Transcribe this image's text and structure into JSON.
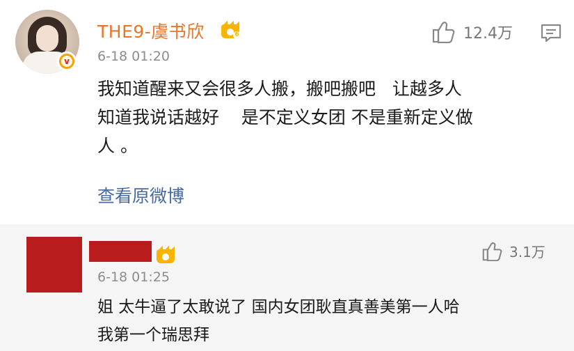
{
  "post": {
    "username": "THE9-虞书欣",
    "vip_level": "6",
    "time": "6-18 01:20",
    "likes": "12.4万",
    "content_lines": [
      "我知道醒来又会很多人搬，搬吧搬吧   让越多人",
      "知道我说话越好    是不定义女团 不是重新定义做",
      "人 。"
    ],
    "view_original": "查看原微博",
    "icons": [
      "avatar",
      "verified-badge",
      "vip-crown-icon",
      "thumbs-up-icon",
      "comment-icon"
    ]
  },
  "reply": {
    "vip_level": "",
    "time": "6-18 01:25",
    "likes": "3.1万",
    "content_lines": [
      "姐 太牛逼了太敢说了 国内女团耿直真善美第一人哈",
      "我第一个瑞思拜"
    ],
    "redacted_color": "#b81c1c"
  },
  "colors": {
    "username": "#ea7528",
    "link": "#466a9f",
    "time": "#8c8c8c",
    "reply_bg": "#f5f5f5",
    "crown": "#f7b500"
  }
}
